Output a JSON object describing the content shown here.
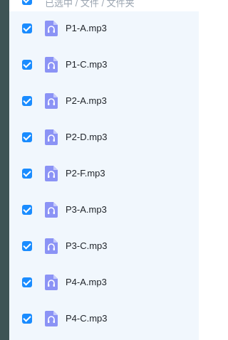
{
  "header": {
    "partial_caption": "已选中 / 文件 / 文件夹"
  },
  "files": [
    {
      "name": "P1-A.mp3",
      "checked": true,
      "icon": "audio-file-icon"
    },
    {
      "name": "P1-C.mp3",
      "checked": true,
      "icon": "audio-file-icon"
    },
    {
      "name": "P2-A.mp3",
      "checked": true,
      "icon": "audio-file-icon"
    },
    {
      "name": "P2-D.mp3",
      "checked": true,
      "icon": "audio-file-icon"
    },
    {
      "name": "P2-F.mp3",
      "checked": true,
      "icon": "audio-file-icon"
    },
    {
      "name": "P3-A.mp3",
      "checked": true,
      "icon": "audio-file-icon"
    },
    {
      "name": "P3-C.mp3",
      "checked": true,
      "icon": "audio-file-icon"
    },
    {
      "name": "P4-A.mp3",
      "checked": true,
      "icon": "audio-file-icon"
    },
    {
      "name": "P4-C.mp3",
      "checked": true,
      "icon": "audio-file-icon"
    }
  ],
  "colors": {
    "checkbox": "#1a8cff",
    "icon": "#8b93f5",
    "panel_bg": "#f1f7fd",
    "sidebar": "#3e5455"
  }
}
